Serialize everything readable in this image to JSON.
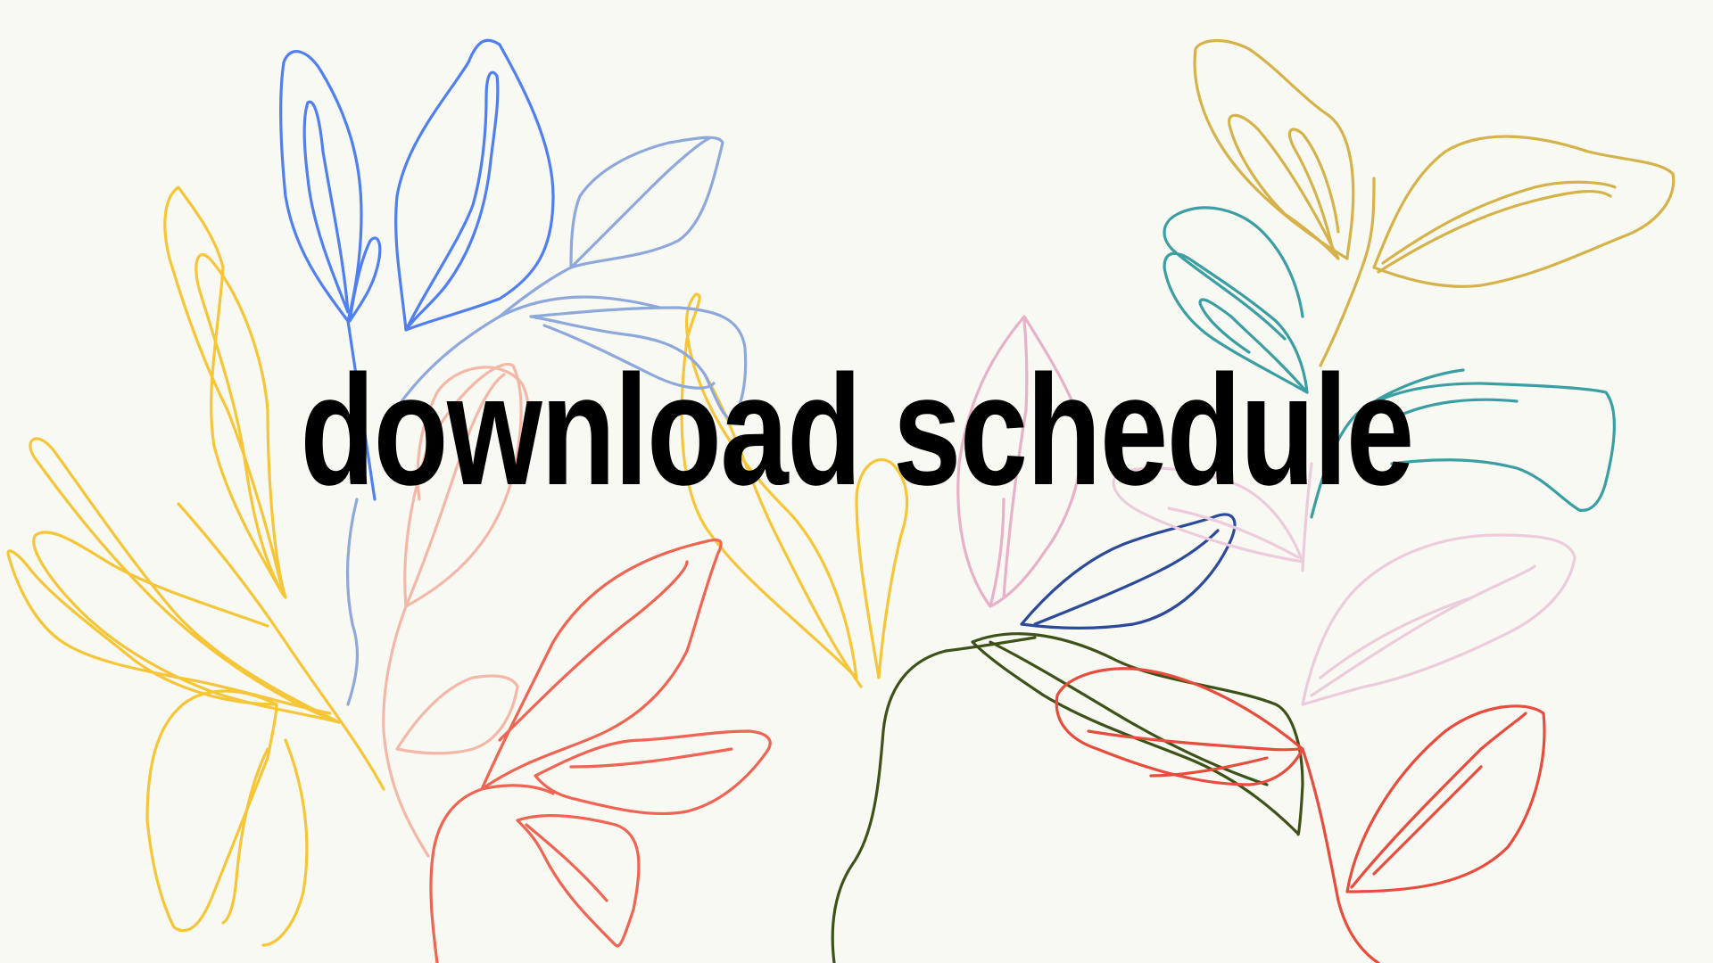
{
  "headline": {
    "text": "download schedule"
  },
  "colors": {
    "background": "#f8f9f3",
    "text": "#000000",
    "yellow": "#f6c638",
    "blue": "#4f7ff0",
    "light_blue": "#8fa8dc",
    "peach": "#f3b8a8",
    "coral": "#ef6452",
    "red": "#e84c3d",
    "mustard": "#d6b24a",
    "teal": "#3a9ea3",
    "pink": "#e7b2c9",
    "light_pink": "#eccbdd",
    "navy": "#2c4a9a",
    "olive": "#3d5218"
  },
  "illustration": {
    "name": "line-art-botanical-leaves"
  }
}
